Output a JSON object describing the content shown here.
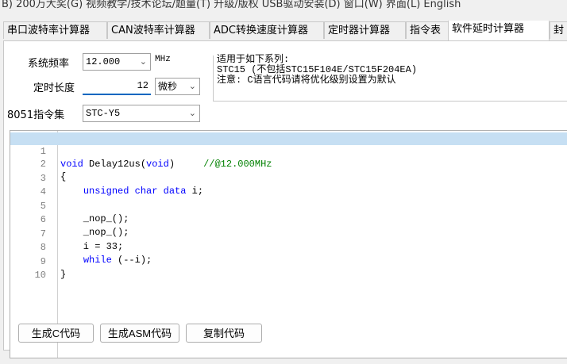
{
  "menubar": {
    "items": [
      "B) 200万大奖(G) 视频教学/技术论坛/题量(T) 升级/版权 USB驱动安装(D) 窗口(W) 界面(L) English"
    ]
  },
  "tabs": [
    {
      "label": "串口波特率计算器"
    },
    {
      "label": "CAN波特率计算器"
    },
    {
      "label": "ADC转换速度计算器"
    },
    {
      "label": "定时器计算器"
    },
    {
      "label": "指令表"
    },
    {
      "label": "软件延时计算器"
    },
    {
      "label": "封"
    }
  ],
  "active_tab": 5,
  "form": {
    "freq_label": "系统频率",
    "freq_value": "12.000",
    "freq_unit": "MHz",
    "delay_label": "定时长度",
    "delay_value": "12",
    "delay_unit": "微秒",
    "isa_label": "8051指令集",
    "isa_value": "STC-Y5"
  },
  "notes": {
    "line1": "适用于如下系列:",
    "line2": "STC15 (不包括STC15F104E/STC15F204EA)",
    "line3": "注意: C语言代码请将优化级别设置为默认"
  },
  "code_lines": [
    {
      "num": "1",
      "text": "void Delay12us(void)     //@12.000MHz"
    },
    {
      "num": "2",
      "text": "{"
    },
    {
      "num": "3",
      "text": "    unsigned char data i;"
    },
    {
      "num": "4",
      "text": ""
    },
    {
      "num": "5",
      "text": "    _nop_();"
    },
    {
      "num": "6",
      "text": "    _nop_();"
    },
    {
      "num": "7",
      "text": "    i = 33;"
    },
    {
      "num": "8",
      "text": "    while (--i);"
    },
    {
      "num": "9",
      "text": "}"
    },
    {
      "num": "10",
      "text": ""
    }
  ],
  "buttons": {
    "gen_c": "生成C代码",
    "gen_asm": "生成ASM代码",
    "copy": "复制代码"
  }
}
